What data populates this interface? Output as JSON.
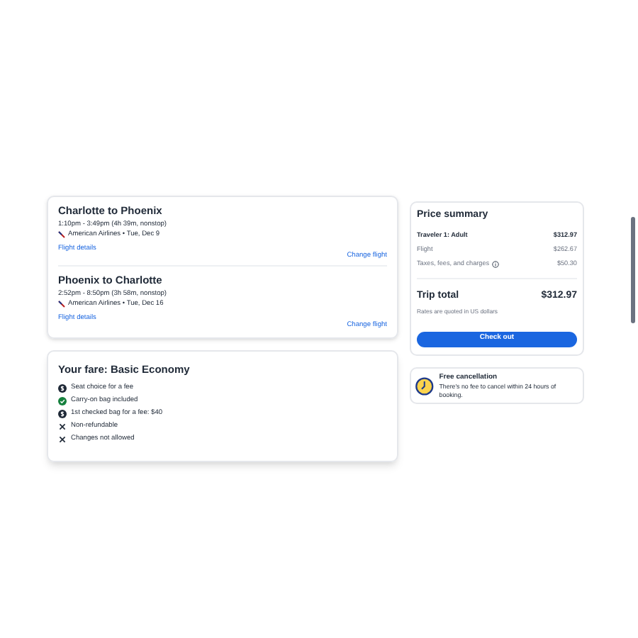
{
  "flights": [
    {
      "title": "Charlotte to Phoenix",
      "times": "1:10pm - 3:49pm (4h 39m, nonstop)",
      "airline": "American Airlines • Tue, Dec 9",
      "details_link": "Flight details",
      "change_link": "Change flight"
    },
    {
      "title": "Phoenix to Charlotte",
      "times": "2:52pm - 8:50pm (3h 58m, nonstop)",
      "airline": "American Airlines • Tue, Dec 16",
      "details_link": "Flight details",
      "change_link": "Change flight"
    }
  ],
  "fare": {
    "title": "Your fare: Basic Economy",
    "items": [
      {
        "kind": "fee",
        "text": "Seat choice for a fee"
      },
      {
        "kind": "included",
        "text": "Carry-on bag included"
      },
      {
        "kind": "fee",
        "text": "1st checked bag for a fee: $40"
      },
      {
        "kind": "no",
        "text": "Non-refundable"
      },
      {
        "kind": "no",
        "text": "Changes not allowed"
      }
    ]
  },
  "price_summary": {
    "title": "Price summary",
    "rows": [
      {
        "kind": "header",
        "label": "Traveler 1: Adult",
        "amount": "$312.97"
      },
      {
        "kind": "detail",
        "label": "Flight",
        "amount": "$262.67"
      },
      {
        "kind": "info",
        "label": "Taxes, fees, and charges",
        "amount": "$50.30"
      }
    ],
    "total_label": "Trip total",
    "total_amount": "$312.97",
    "note": "Rates are quoted in US dollars",
    "button": "Check out"
  },
  "cancellation": {
    "title": "Free cancellation",
    "text": "There's no fee to cancel within 24 hours of booking."
  }
}
